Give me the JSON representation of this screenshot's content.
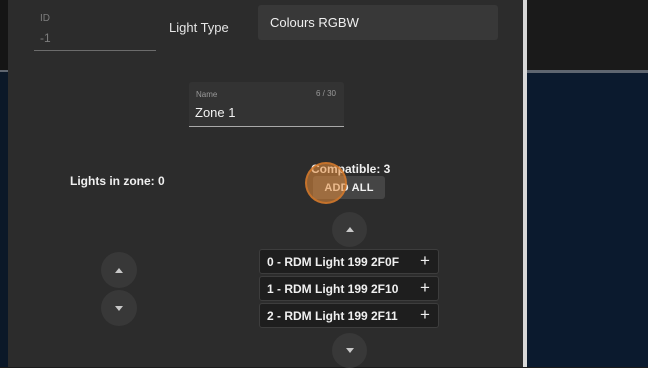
{
  "id_field": {
    "label": "ID",
    "value": "-1"
  },
  "light_type": {
    "label": "Light Type",
    "value": "Colours RGBW"
  },
  "name_field": {
    "label": "Name",
    "value": "Zone 1",
    "counter": "6 / 30"
  },
  "zone": {
    "lights_label": "Lights in zone: 0"
  },
  "compatible": {
    "label": "Compatible: 3",
    "add_all_label": "ADD ALL",
    "items": [
      {
        "label": "0 - RDM Light 199 2F0F",
        "action_icon": "plus-icon"
      },
      {
        "label": "1 - RDM Light 199 2F10",
        "action_icon": "plus-icon"
      },
      {
        "label": "2 - RDM Light 199 2F11",
        "action_icon": "plus-icon"
      }
    ]
  },
  "icons": {
    "zone_up": "chevron-up-icon",
    "zone_down": "chevron-down-icon",
    "list_up": "chevron-up-icon",
    "list_down": "chevron-down-icon"
  },
  "colors": {
    "dialog_bg": "#2c2c2c",
    "ripple_accent": "#e88e3c",
    "side_panel_bg": "#0b1a2e"
  }
}
